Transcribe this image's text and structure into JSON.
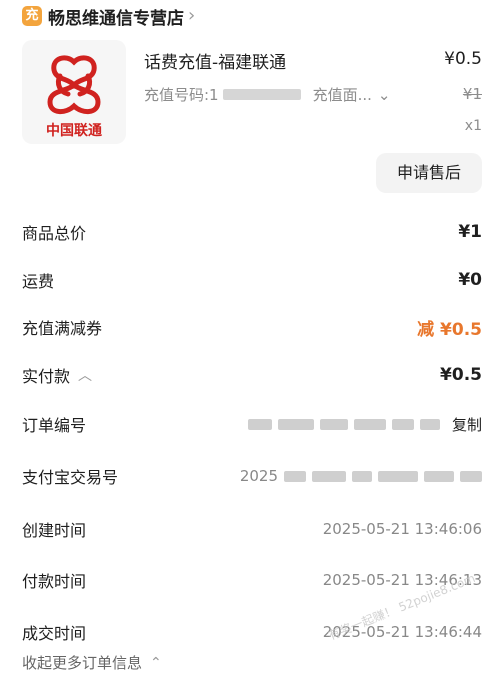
{
  "shop": {
    "badge": "充",
    "name": "畅思维通信专营店",
    "chevron": "›"
  },
  "product": {
    "logo_text": "中国联通",
    "title": "话费充值-福建联通",
    "price": "¥0.5",
    "sub_label": "充值号码:1",
    "sub_face": "充值面...",
    "sub_chevron": "⌄",
    "old_price": "¥1",
    "qty": "x1"
  },
  "actions": {
    "after_sale": "申请售后"
  },
  "summary": [
    {
      "label": "商品总价",
      "value": "¥1"
    },
    {
      "label": "运费",
      "value": "¥0"
    },
    {
      "label": "充值满减券",
      "value": "减 ¥0.5"
    },
    {
      "label": "实付款",
      "value": "¥0.5"
    }
  ],
  "order": {
    "order_no_label": "订单编号",
    "copy_label": "复制",
    "alipay_label": "支付宝交易号",
    "alipay_prefix": "2025",
    "created_label": "创建时间",
    "created": "2025-05-21 13:46:06",
    "paid_label": "付款时间",
    "paid": "2025-05-21 13:46:13",
    "done_label": "成交时间",
    "done": "2025-05-21 13:46:44"
  },
  "more": {
    "label": "收起更多订单信息",
    "chevron": "⌃"
  },
  "watermark": "有奖一起赚！ 52pojie8.com",
  "colors": {
    "accent_orange": "#e8772d",
    "unicom_red": "#d0221f",
    "badge": "#f3a43d"
  }
}
